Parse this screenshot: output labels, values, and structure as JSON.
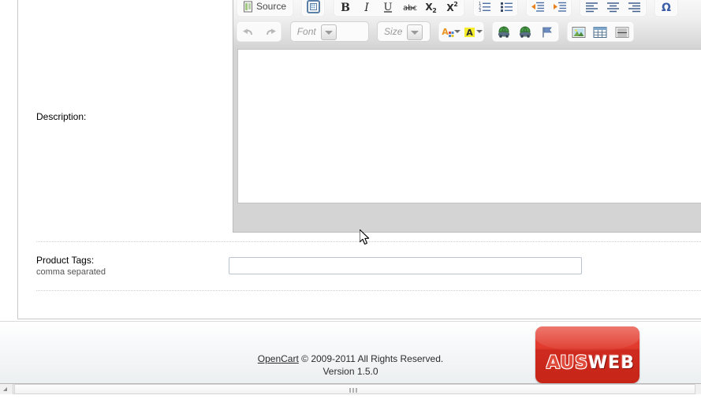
{
  "form": {
    "rows": [
      {
        "label": "Description:",
        "sublabel": "",
        "field": "rich-text-editor"
      },
      {
        "label": "Product Tags:",
        "sublabel": "comma separated",
        "field": "text-input",
        "value": "",
        "placeholder": ""
      }
    ]
  },
  "editor": {
    "toolbar_row1": [
      {
        "name": "source-button",
        "icon": "source-icon",
        "label": "Source",
        "type": "button"
      },
      {
        "name": "templates-button",
        "icon": "templates-icon",
        "label": "",
        "type": "button"
      },
      {
        "name": "bold-button",
        "icon": "bold-icon",
        "label": "B",
        "type": "button"
      },
      {
        "name": "italic-button",
        "icon": "italic-icon",
        "label": "I",
        "type": "button"
      },
      {
        "name": "underline-button",
        "icon": "underline-icon",
        "label": "U",
        "type": "button"
      },
      {
        "name": "strikethrough-button",
        "icon": "strikethrough-icon",
        "label": "abc",
        "type": "button"
      },
      {
        "name": "subscript-button",
        "icon": "subscript-icon",
        "label": "X2",
        "type": "button"
      },
      {
        "name": "superscript-button",
        "icon": "superscript-icon",
        "label": "X2",
        "type": "button"
      },
      {
        "name": "numbered-list-button",
        "icon": "numbered-list-icon",
        "label": "",
        "type": "button"
      },
      {
        "name": "bulleted-list-button",
        "icon": "bulleted-list-icon",
        "label": "",
        "type": "button"
      },
      {
        "name": "outdent-button",
        "icon": "outdent-icon",
        "label": "",
        "type": "button"
      },
      {
        "name": "indent-button",
        "icon": "indent-icon",
        "label": "",
        "type": "button"
      },
      {
        "name": "align-left-button",
        "icon": "align-left-icon",
        "label": "",
        "type": "button"
      },
      {
        "name": "align-center-button",
        "icon": "align-center-icon",
        "label": "",
        "type": "button"
      },
      {
        "name": "align-right-button",
        "icon": "align-right-icon",
        "label": "",
        "type": "button"
      },
      {
        "name": "special-char-button",
        "icon": "omega-icon",
        "label": "Ω",
        "type": "button"
      }
    ],
    "toolbar_row2": [
      {
        "name": "undo-button",
        "icon": "undo-arrow-icon",
        "label": "",
        "type": "button"
      },
      {
        "name": "redo-button",
        "icon": "redo-arrow-icon",
        "label": "",
        "type": "button"
      },
      {
        "name": "font-combo",
        "icon": "chevron-down-icon",
        "label": "Font",
        "type": "combo"
      },
      {
        "name": "size-combo",
        "icon": "chevron-down-icon",
        "label": "Size",
        "type": "combo"
      },
      {
        "name": "text-color-button",
        "icon": "text-color-icon",
        "label": "A",
        "type": "split"
      },
      {
        "name": "bg-color-button",
        "icon": "background-color-icon",
        "label": "A",
        "type": "split"
      },
      {
        "name": "link-button",
        "icon": "link-globe-icon",
        "label": "",
        "type": "button"
      },
      {
        "name": "unlink-button",
        "icon": "unlink-globe-icon",
        "label": "",
        "type": "button"
      },
      {
        "name": "anchor-button",
        "icon": "anchor-flag-icon",
        "label": "",
        "type": "button"
      },
      {
        "name": "image-button",
        "icon": "image-icon",
        "label": "",
        "type": "button"
      },
      {
        "name": "table-button",
        "icon": "table-icon",
        "label": "",
        "type": "button"
      },
      {
        "name": "horizontal-rule-button",
        "icon": "horizontal-rule-icon",
        "label": "",
        "type": "button"
      }
    ],
    "body_text": ""
  },
  "footer": {
    "link_text": "OpenCart",
    "copyright": " © 2009-2011 All Rights Reserved.",
    "version": "Version 1.5.0"
  },
  "logo": {
    "part1": "AUS",
    "part2": "WEB",
    "color": "#d5301f"
  },
  "colors": {
    "toolbar_bg": "#d4d4d4",
    "panel_border": "#c9c9c9",
    "input_border": "#b9c4d0",
    "text": "#000000"
  }
}
